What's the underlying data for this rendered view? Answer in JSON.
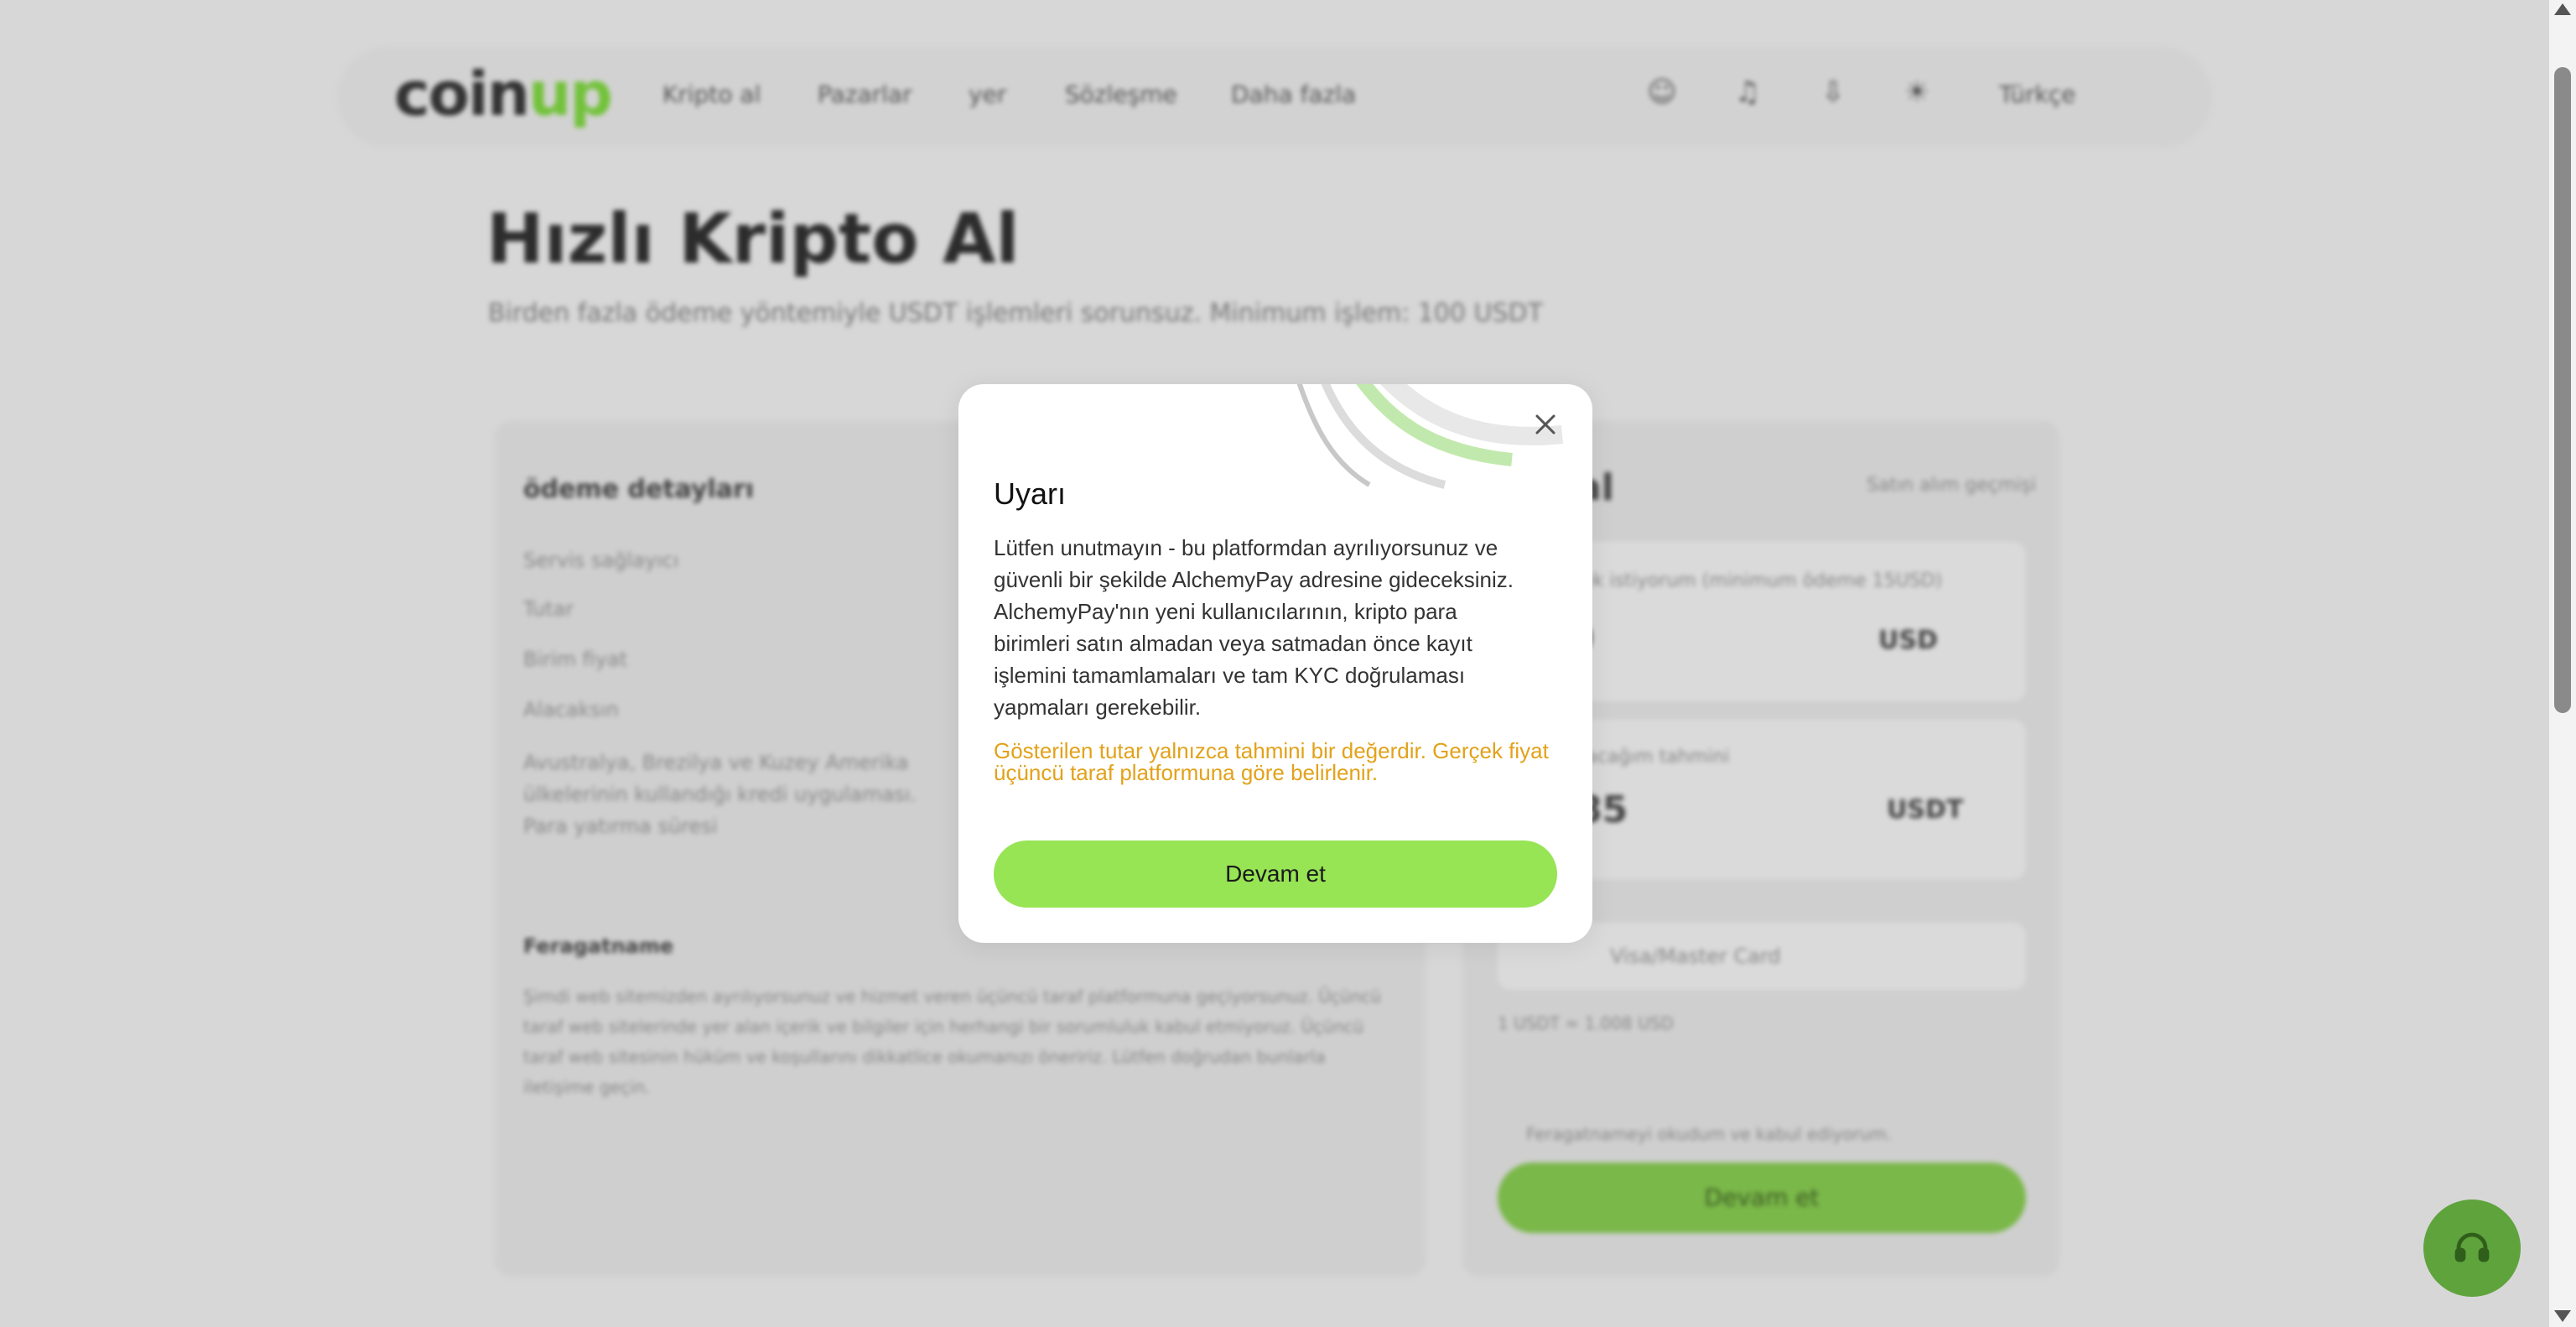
{
  "header": {
    "logo_main": "coin",
    "logo_accent": "up",
    "nav": [
      "Kripto al",
      "Pazarlar",
      "yer",
      "Sözleşme",
      "Daha fazla"
    ],
    "language": "Türkçe"
  },
  "page": {
    "title": "Hızlı Kripto Al",
    "subtitle": "Birden fazla ödeme yöntemiyle USDT işlemleri sorunsuz. Minimum işlem: 100 USDT"
  },
  "left_card": {
    "heading": "ödeme detayları",
    "rows": [
      "Servis sağlayıcı",
      "Tutar",
      "Birim fiyat",
      "Alacaksın"
    ],
    "region_note": "Avustralya, Brezilya ve Kuzey Amerika ülkelerinin kullandığı kredi uygulaması. Para yatırma süresi",
    "disclaimer_heading": "Feragatname",
    "disclaimer_text": "Şimdi web sitemizden ayrılıyorsunuz ve hizmet veren üçüncü taraf platformuna geçiyorsunuz. Üçüncü taraf web sitelerinde yer alan içerik ve bilgiler için herhangi bir sorumluluk kabul etmiyoruz. Üçüncü taraf web sitesinin hüküm ve koşullarını dikkatlice okumanızı öneririz. Lütfen doğrudan bunlarla iletişime geçin."
  },
  "right_card": {
    "heading_partial": "al",
    "history_link": "Satın alım geçmişi",
    "pay_label": "Ödemek istiyorum (minimum ödeme 15USD)",
    "pay_value": "0",
    "pay_currency": "USD",
    "receive_label": "Alacağım tahmini",
    "receive_value": "85",
    "receive_currency": "USDT",
    "payment_method": "Visa/Master Card",
    "rate": "1 USDT ≈ 1.008 USD",
    "agree": "Feragatnameyi okudum ve kabul ediyorum.",
    "button": "Devam et"
  },
  "modal": {
    "title": "Uyarı",
    "body": "Lütfen unutmayın - bu platformdan ayrılıyorsunuz ve güvenli bir şekilde AlchemyPay adresine gideceksiniz. AlchemyPay'nın yeni kullanıcılarının, kripto para birimleri satın almadan veya satmadan önce kayıt işlemini tamamlamaları ve tam KYC doğrulaması yapmaları gerekebilir.",
    "warning": "Gösterilen tutar yalnızca tahmini bir değerdir. Gerçek fiyat üçüncü taraf platformuna göre belirlenir.",
    "confirm": "Devam et"
  },
  "colors": {
    "accent": "#97e455",
    "warning": "#e2a21a",
    "overlay": "#d7d7d7"
  }
}
